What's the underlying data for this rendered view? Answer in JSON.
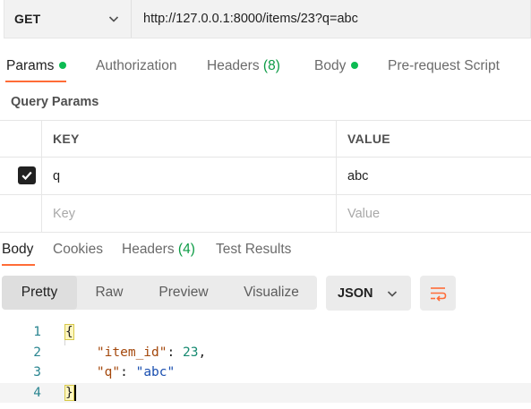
{
  "request": {
    "method": "GET",
    "url": "http://127.0.0.1:8000/items/23?q=abc"
  },
  "request_tabs": {
    "params": "Params",
    "authorization": "Authorization",
    "headers": "Headers",
    "headers_count": "(8)",
    "body": "Body",
    "prerequest": "Pre-request Script"
  },
  "query_params": {
    "title": "Query Params",
    "col_key": "KEY",
    "col_value": "VALUE",
    "rows": [
      {
        "checked": true,
        "key": "q",
        "value": "abc"
      }
    ],
    "key_placeholder": "Key",
    "value_placeholder": "Value"
  },
  "response_tabs": {
    "body": "Body",
    "cookies": "Cookies",
    "headers": "Headers",
    "headers_count": "(4)",
    "test_results": "Test Results"
  },
  "format": {
    "pretty": "Pretty",
    "raw": "Raw",
    "preview": "Preview",
    "visualize": "Visualize",
    "language": "JSON"
  },
  "code": {
    "line_numbers": [
      "1",
      "2",
      "3",
      "4"
    ],
    "open_brace": "{",
    "close_brace": "}",
    "line2_key": "\"item_id\"",
    "line2_value": "23",
    "line3_key": "\"q\"",
    "line3_value": "\"abc\""
  },
  "colors": {
    "accent": "#ff6c37",
    "status_dot": "#0cbb52",
    "count_green": "#0c9b45"
  },
  "icons": {
    "method_dropdown": "chevron-down-icon",
    "language_dropdown": "chevron-down-icon",
    "wrap": "wrap-lines-icon",
    "checkbox": "checkmark-icon"
  }
}
